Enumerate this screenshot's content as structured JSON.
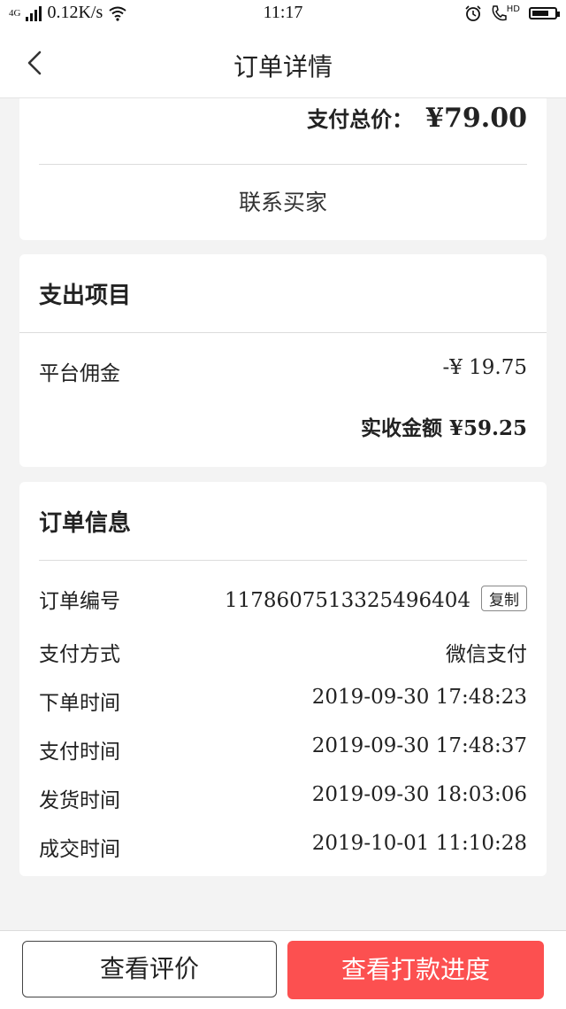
{
  "status_bar": {
    "network": "4G",
    "speed": "0.12K/s",
    "time": "11:17",
    "hd_label": "HD",
    "icons": [
      "signal-icon",
      "wifi-icon",
      "alarm-icon",
      "hd-call-icon",
      "battery-icon"
    ]
  },
  "nav": {
    "title": "订单详情",
    "back_icon": "chevron-left-icon"
  },
  "summary": {
    "total_label": "支付总价：",
    "total_value": "¥79.00",
    "contact_button": "联系买家"
  },
  "expenses": {
    "title": "支出项目",
    "items": [
      {
        "label": "平台佣金",
        "value": "-¥ 19.75"
      }
    ],
    "received": "实收金额 ¥59.25"
  },
  "order_info": {
    "title": "订单信息",
    "order_no_label": "订单编号",
    "order_no_value": "1178607513325496404",
    "copy_button": "复制",
    "rows": [
      {
        "label": "支付方式",
        "value": "微信支付"
      },
      {
        "label": "下单时间",
        "value": "2019-09-30 17:48:23"
      },
      {
        "label": "支付时间",
        "value": "2019-09-30 17:48:37"
      },
      {
        "label": "发货时间",
        "value": "2019-09-30 18:03:06"
      },
      {
        "label": "成交时间",
        "value": "2019-10-01 11:10:28"
      }
    ]
  },
  "bottom": {
    "review_button": "查看评价",
    "payment_progress_button": "查看打款进度"
  },
  "colors": {
    "primary": "#fc5050",
    "background": "#f3f3f3",
    "card": "#ffffff"
  }
}
